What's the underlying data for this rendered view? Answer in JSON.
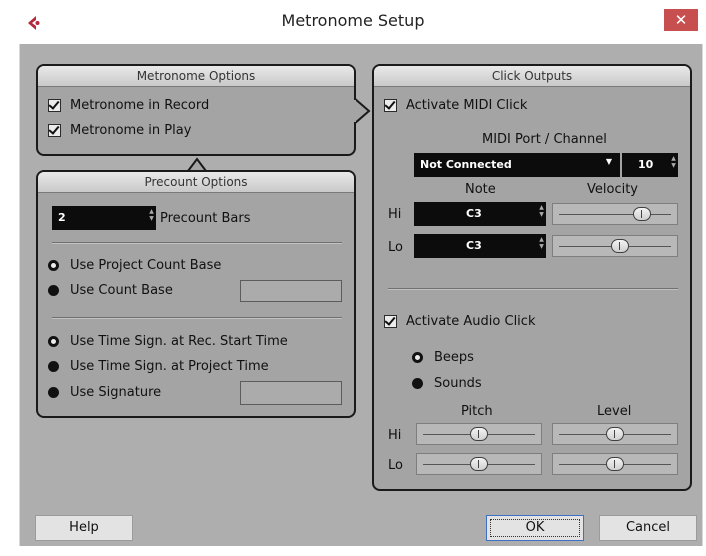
{
  "window": {
    "title": "Metronome Setup",
    "close_glyph": "✕",
    "accent_close": "#c84f4f"
  },
  "metronome_options": {
    "header": "Metronome Options",
    "record_label": "Metronome in Record",
    "record_checked": true,
    "play_label": "Metronome in Play",
    "play_checked": true
  },
  "precount_options": {
    "header": "Precount Options",
    "bars_value": "2",
    "bars_label": "Precount Bars",
    "project_count_base_label": "Use Project Count Base",
    "count_base_label": "Use Count Base",
    "time_sign_rec_label": "Use Time Sign. at Rec. Start Time",
    "time_sign_project_label": "Use Time Sign. at Project Time",
    "signature_label": "Use Signature"
  },
  "click_outputs": {
    "header": "Click Outputs",
    "midi_click_label": "Activate MIDI Click",
    "midi_click_checked": true,
    "midi_port_channel_label": "MIDI Port / Channel",
    "midi_port_value": "Not Connected",
    "midi_channel_value": "10",
    "note_label": "Note",
    "velocity_label": "Velocity",
    "hi_label": "Hi",
    "lo_label": "Lo",
    "hi_note": "C3",
    "lo_note": "C3",
    "hi_velocity_fraction": 0.78,
    "lo_velocity_fraction": 0.55,
    "audio_click_label": "Activate Audio Click",
    "audio_click_checked": true,
    "beeps_label": "Beeps",
    "sounds_label": "Sounds",
    "pitch_label": "Pitch",
    "level_label": "Level",
    "hi_pitch_fraction": 0.5,
    "lo_pitch_fraction": 0.5,
    "hi_level_fraction": 0.5,
    "lo_level_fraction": 0.5
  },
  "buttons": {
    "help": "Help",
    "ok": "OK",
    "cancel": "Cancel"
  }
}
